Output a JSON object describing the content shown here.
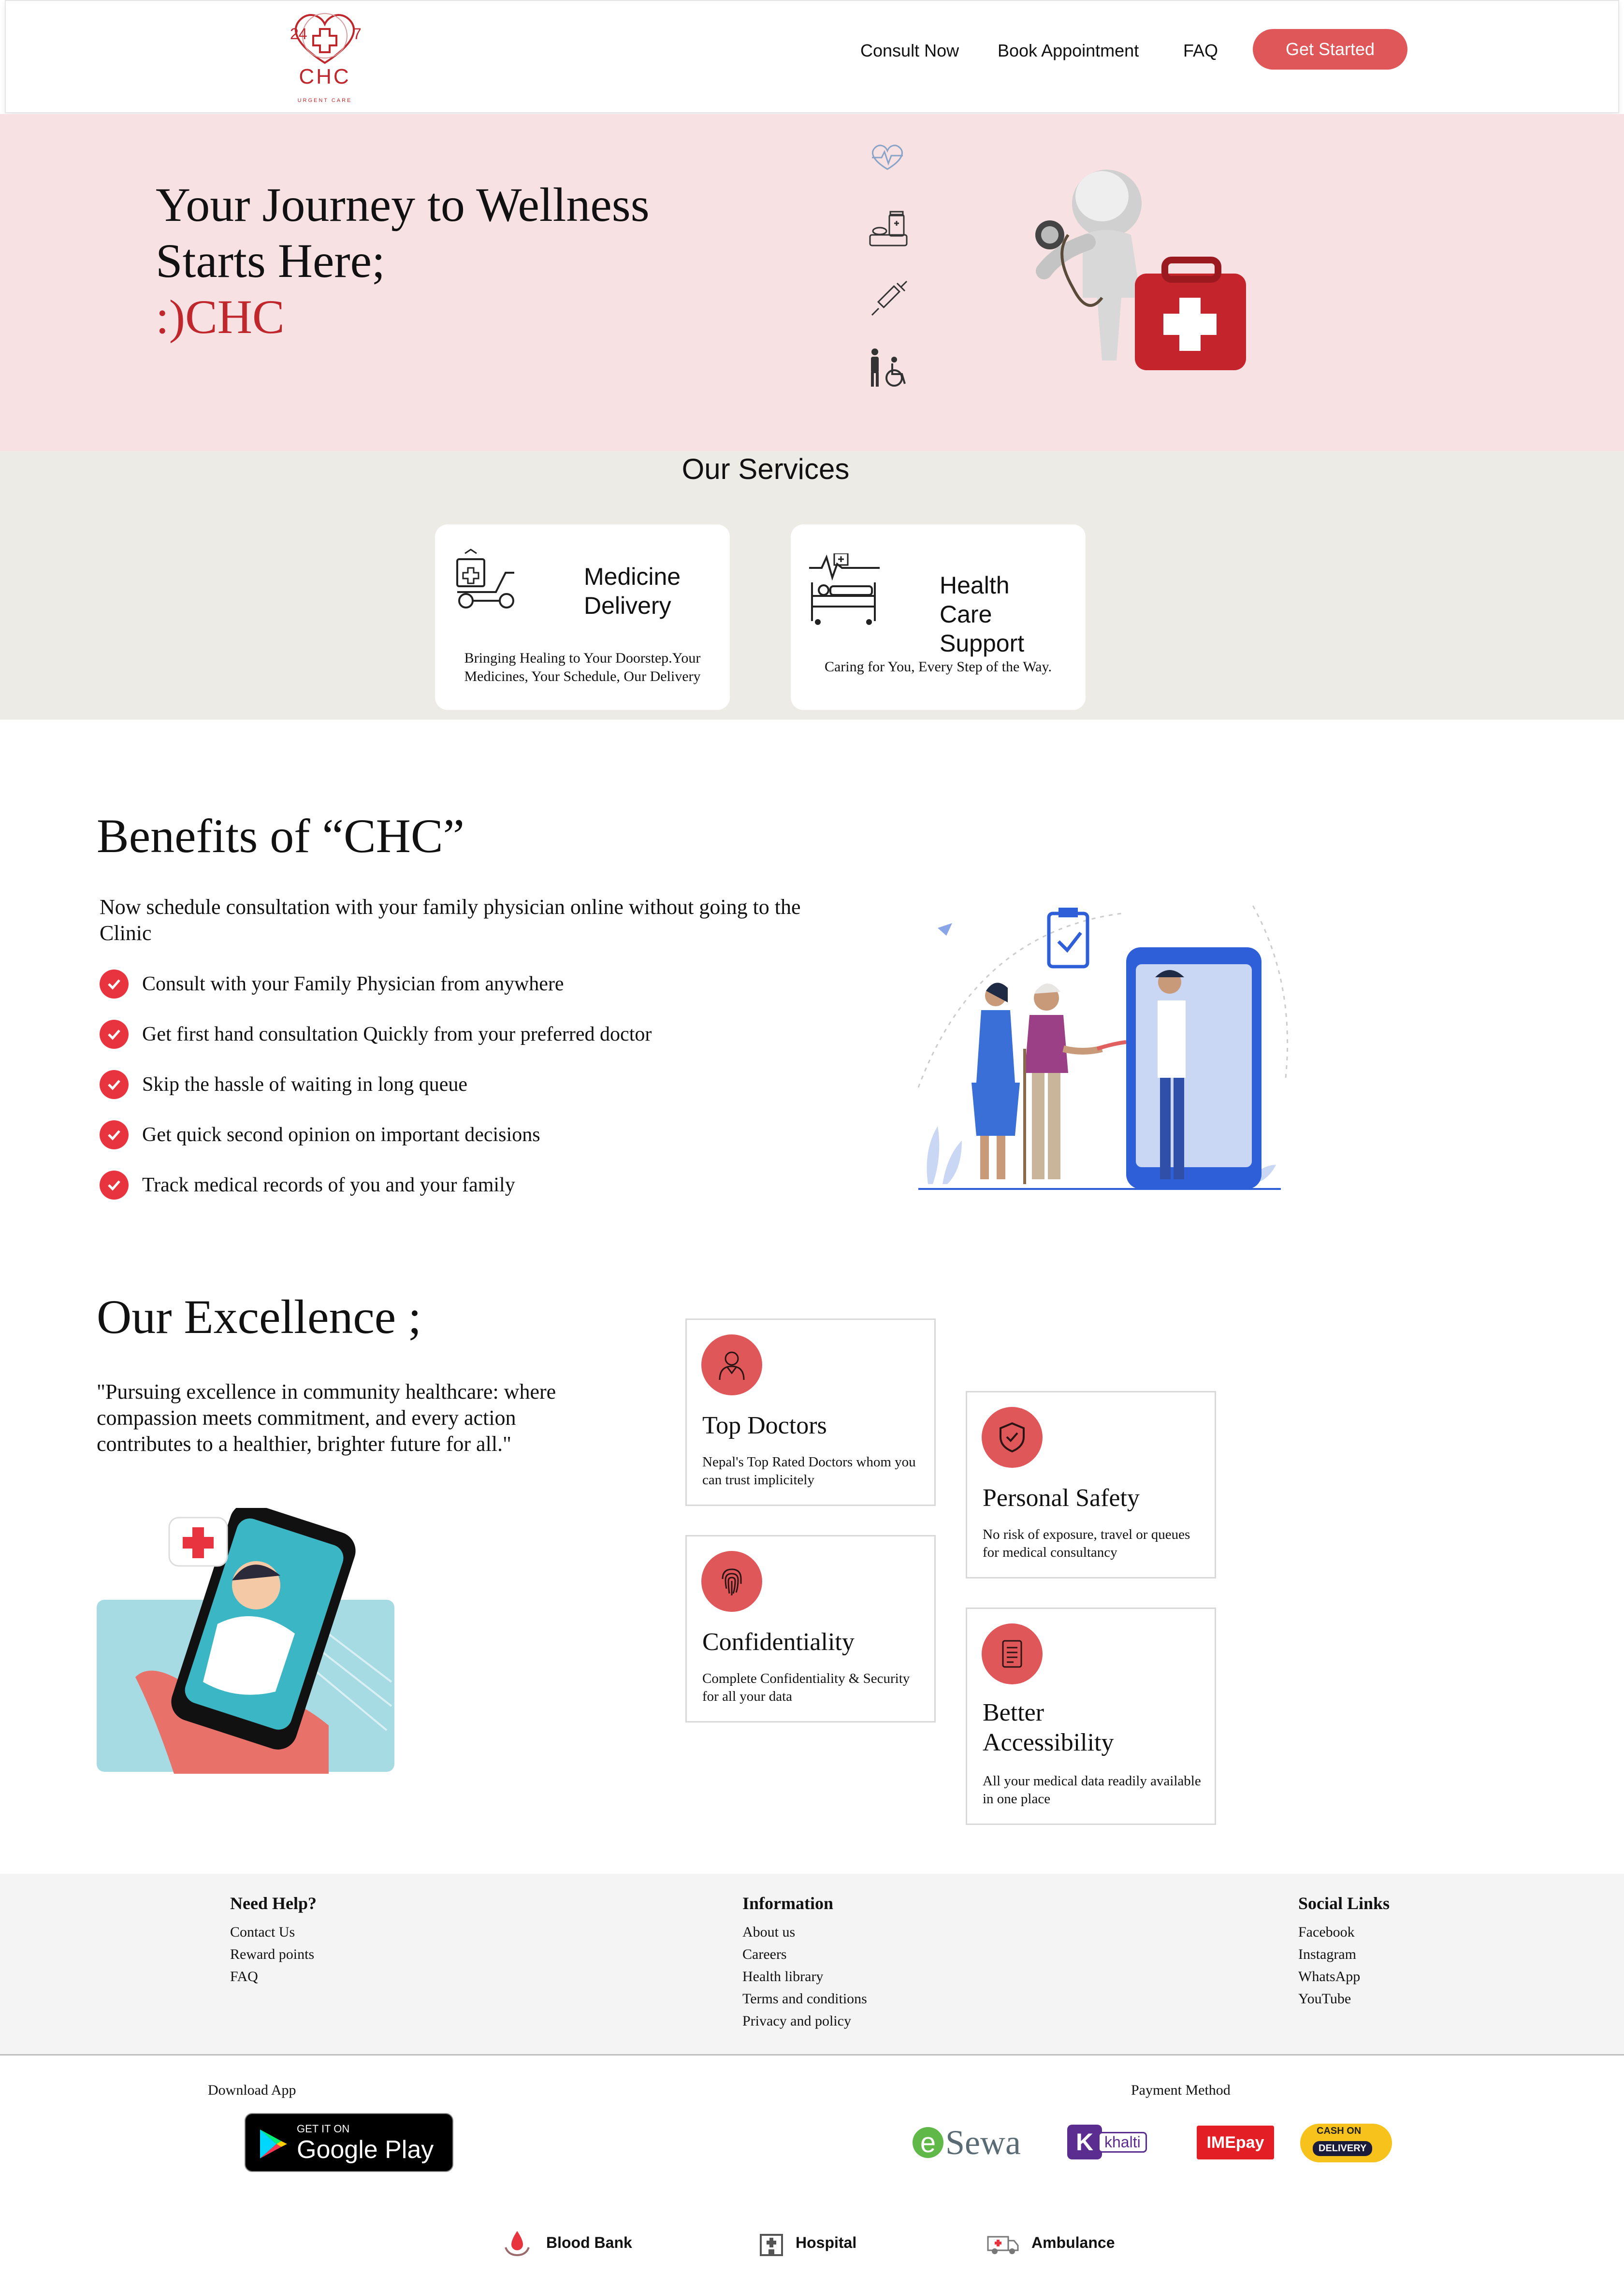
{
  "nav": {
    "logo_top_left": "24",
    "logo_top_right": "7",
    "logo_text": "CHC",
    "logo_sub": "URGENT CARE",
    "links": [
      "Consult Now",
      "Book Appointment",
      "FAQ"
    ],
    "cta": "Get Started"
  },
  "hero": {
    "line1": "Your Journey to Wellness",
    "line2": "Starts Here;",
    "brand": ":)CHC",
    "icons": [
      "heartbeat-icon",
      "medicine-icon",
      "syringe-icon",
      "wheelchair-icon"
    ]
  },
  "services": {
    "title": "Our Services",
    "cards": [
      {
        "title_line1": "Medicine",
        "title_line2": "Delivery",
        "desc": "Bringing Healing to Your Doorstep.Your Medicines, Your Schedule, Our Delivery"
      },
      {
        "title_line1": "Health",
        "title_line2": "Care",
        "title_line3": "Support",
        "desc": "Caring for You, Every Step of the Way."
      }
    ]
  },
  "benefits": {
    "title": "Benefits of “CHC”",
    "intro": "Now schedule consultation with your family physician online without going to the Clinic",
    "items": [
      "Consult with your Family Physician from anywhere",
      "Get first hand consultation Quickly from your preferred doctor",
      "Skip the hassle of waiting in long queue",
      "Get quick second opinion on important decisions",
      "Track medical records of you and your family"
    ]
  },
  "excellence": {
    "title": "Our Excellence ;",
    "quote": "\"Pursuing excellence in community healthcare: where compassion meets commitment, and every action contributes to a healthier, brighter future for all.\"",
    "cards": [
      {
        "title": "Top Doctors",
        "desc": "Nepal's Top Rated Doctors whom you can trust implicitely"
      },
      {
        "title": "Personal Safety",
        "desc": "No risk of exposure, travel or queues for medical consultancy"
      },
      {
        "title": "Confidentiality",
        "desc": "Complete Confidentiality & Security for all your data"
      },
      {
        "title_line1": "Better",
        "title_line2": "Accessibility",
        "desc": "All your medical data readily available in one place"
      }
    ]
  },
  "footer": {
    "help": {
      "title": "Need Help?",
      "links": [
        "Contact Us",
        "Reward points",
        "FAQ"
      ]
    },
    "info": {
      "title": "Information",
      "links": [
        "About us",
        "Careers",
        "Health library",
        "Terms and conditions",
        "Privacy and policy"
      ]
    },
    "social": {
      "title": "Social Links",
      "links": [
        "Facebook",
        "Instagram",
        "WhatsApp",
        "YouTube"
      ]
    },
    "download_label": "Download App",
    "google_play_small": "GET IT ON",
    "google_play_big": "Google Play",
    "payment_label": "Payment Method",
    "payments": {
      "esewa_e": "e",
      "esewa": "Sewa",
      "khalti_k": "K",
      "khalti": "khalti",
      "imepay": "IMEpay",
      "cod_top": "CASH ON",
      "cod_bottom": "DELIVERY"
    },
    "bottom_links": [
      "Blood Bank",
      "Hospital",
      "Ambulance"
    ]
  },
  "colors": {
    "accent": "#e0575a",
    "brand_red": "#c0272d",
    "hero_bg": "#f7e1e2",
    "services_bg": "#ecebe5",
    "check_red": "#e8343f"
  }
}
